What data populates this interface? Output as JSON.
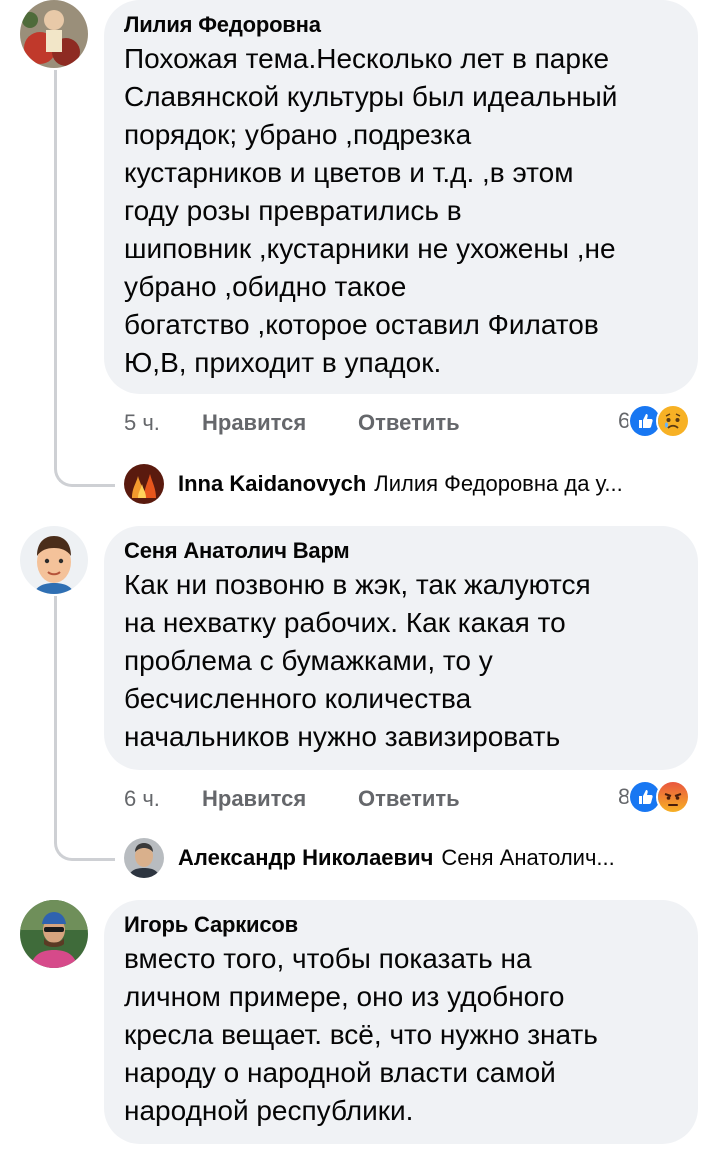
{
  "comments": [
    {
      "author": "Лилия Федоровна",
      "text": "Похожая тема.Несколько лет в парке\nСлавянской культуры был идеальный\nпорядок; убрано ,подрезка\nкустарников и цветов и т.д. ,в этом\nгоду розы превратились в\nшиповник ,кустарники не ухожены ,не\nубрано ,обидно такое\nбогатство ,которое оставил Филатов\nЮ,В, приходит в упадок.",
      "time": "5 ч.",
      "like_label": "Нравится",
      "reply_label": "Ответить",
      "reaction_count": "6",
      "reactions": [
        "like-icon",
        "sad-icon"
      ],
      "reply_preview": {
        "author": "Inna Kaidanovych",
        "text": "Лилия Федоровна да у..."
      }
    },
    {
      "author": "Сеня Анатолич Варм",
      "text": "Как ни позвоню в жэк, так жалуются\nна нехватку рабочих. Как какая то\nпроблема с бумажками, то у\nбесчисленного количества\nначальников нужно завизировать",
      "time": "6 ч.",
      "like_label": "Нравится",
      "reply_label": "Ответить",
      "reaction_count": "8",
      "reactions": [
        "like-icon",
        "angry-icon"
      ],
      "reply_preview": {
        "author": "Александр Николаевич",
        "text": "Сеня Анатолич..."
      }
    },
    {
      "author": "Игорь Саркисов",
      "text": "вместо того, чтобы показать на\nличном примере, оно из удобного\nкресла вещает. всё, что нужно знать\nнароду о народной власти самой\nнародной республики."
    }
  ],
  "colors": {
    "bubble": "#f0f2f5",
    "meta_text": "#65676b",
    "like_blue": "#1877f2",
    "thread_line": "#ced0d4"
  }
}
